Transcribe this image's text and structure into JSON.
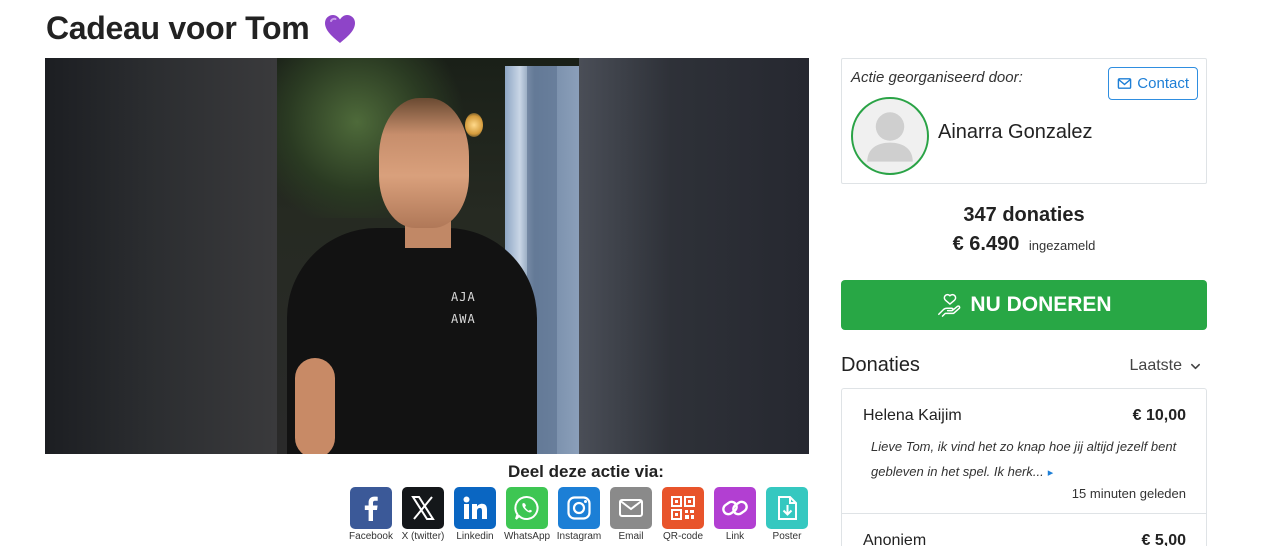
{
  "page": {
    "title": "Cadeau voor Tom",
    "title_icon": "purple-heart-icon"
  },
  "photo": {
    "shirt_text_line1": "AJA",
    "shirt_text_line2": "AWA"
  },
  "share": {
    "title": "Deel deze actie via:",
    "items": [
      {
        "label": "Facebook",
        "icon": "facebook-icon",
        "color": "#3b5998"
      },
      {
        "label": "X (twitter)",
        "icon": "x-icon",
        "color": "#14171a"
      },
      {
        "label": "Linkedin",
        "icon": "linkedin-icon",
        "color": "#0a66c2"
      },
      {
        "label": "WhatsApp",
        "icon": "whatsapp-icon",
        "color": "#3ec653"
      },
      {
        "label": "Instagram",
        "icon": "instagram-icon",
        "color": "#1c7fd6"
      },
      {
        "label": "Email",
        "icon": "email-icon",
        "color": "#8a8a8a"
      },
      {
        "label": "QR-code",
        "icon": "qr-code-icon",
        "color": "#e8542b"
      },
      {
        "label": "Link",
        "icon": "link-icon",
        "color": "#b23fd2"
      },
      {
        "label": "Poster",
        "icon": "poster-icon",
        "color": "#35c8c0"
      }
    ]
  },
  "organizer": {
    "label": "Actie georganiseerd door:",
    "name": "Ainarra Gonzalez",
    "contact_label": "Contact"
  },
  "stats": {
    "donations_count": "347 donaties",
    "amount": "€ 6.490",
    "amount_suffix": "ingezameld"
  },
  "donate_button": {
    "label": "NU DONEREN"
  },
  "donations": {
    "title": "Donaties",
    "sort_label": "Laatste",
    "items": [
      {
        "name": "Helena Kaijim",
        "amount": "€ 10,00",
        "message": "Lieve Tom, ik vind het zo knap hoe jij altijd jezelf bent gebleven in het spel. Ik herk...",
        "time": "15 minuten geleden"
      },
      {
        "name": "Anoniem",
        "amount": "€ 5,00"
      }
    ]
  },
  "colors": {
    "accent_green": "#28a745",
    "link_blue": "#1e7fd6",
    "heart_purple": "#8e44c8"
  }
}
